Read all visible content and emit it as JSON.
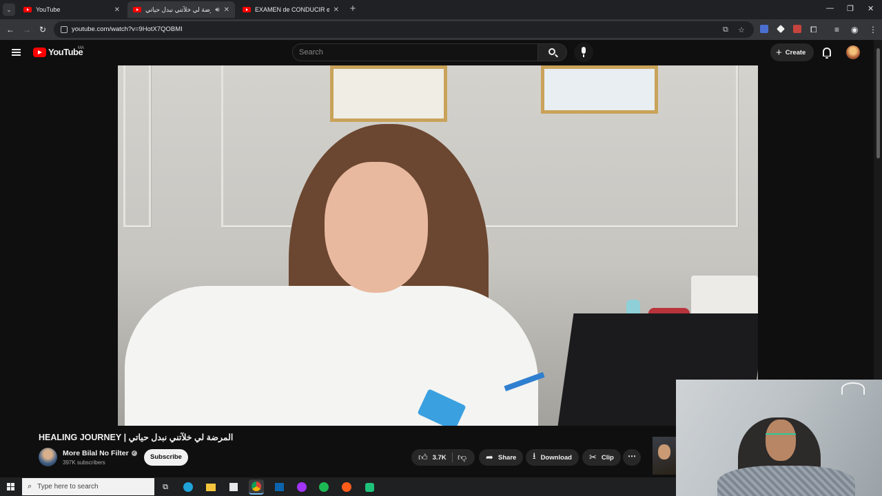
{
  "browser": {
    "tabs": [
      {
        "title": "YouTube",
        "active": false
      },
      {
        "title": "المرضة لي خلآتني نبدل حياتي",
        "active": true
      },
      {
        "title": "EXAMEN de CONDUCIR en",
        "active": false
      }
    ],
    "new_tab": "+",
    "url": "youtube.com/watch?v=9HotX7QOBMI"
  },
  "youtube": {
    "logo_text": "YouTube",
    "country_code": "MA",
    "search_placeholder": "Search",
    "create_label": "Create"
  },
  "video": {
    "title": "المرضة لي خلآتني نبدل حياتي | HEALING JOURNEY",
    "channel_name": "More Bilal No Filter",
    "subscribers": "397K subscribers",
    "subscribe_label": "Subscribe",
    "likes": "3.7K",
    "share_label": "Share",
    "download_label": "Download",
    "clip_label": "Clip",
    "more_label": "⋯"
  },
  "taskbar": {
    "search_placeholder": "Type here to search"
  },
  "colors": {
    "yt_red": "#ff0000",
    "background": "#0f0f0f",
    "chrome_dark": "#202124",
    "chrome_toolbar": "#35363a"
  }
}
